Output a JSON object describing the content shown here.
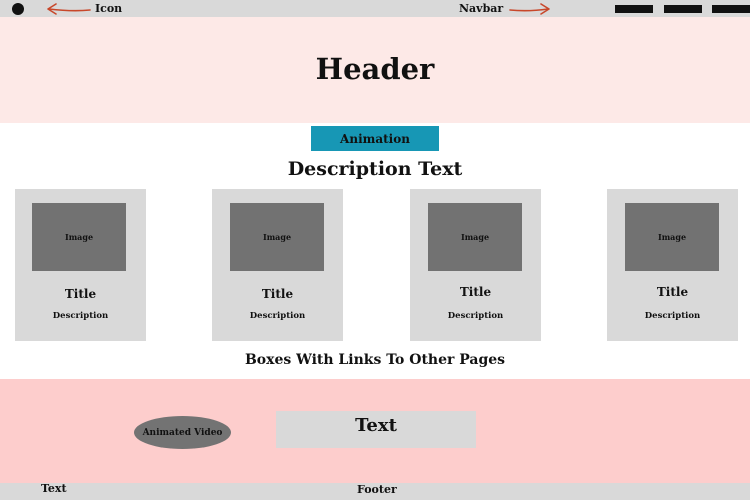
{
  "navbar": {
    "icon_label": "Icon",
    "navbar_label": "Navbar",
    "arrow_color": "#c8472a",
    "background": "#d9d9d9"
  },
  "header": {
    "title": "Header",
    "background": "#fde9e7"
  },
  "animation": {
    "label": "Animation",
    "color": "#1797b5"
  },
  "description_text": "Description Text",
  "cards": [
    {
      "image_label": "Image",
      "title": "Title",
      "description": "Description"
    },
    {
      "image_label": "Image",
      "title": "Title",
      "description": "Description"
    },
    {
      "image_label": "Image",
      "title": "Title",
      "description": "Description"
    },
    {
      "image_label": "Image",
      "title": "Title",
      "description": "Description"
    }
  ],
  "boxes_caption": "Boxes With Links To Other Pages",
  "feature": {
    "video_label": "Animated Video",
    "text_label": "Text",
    "background": "#fdcdcc"
  },
  "footer": {
    "text": "Text",
    "label": "Footer"
  }
}
